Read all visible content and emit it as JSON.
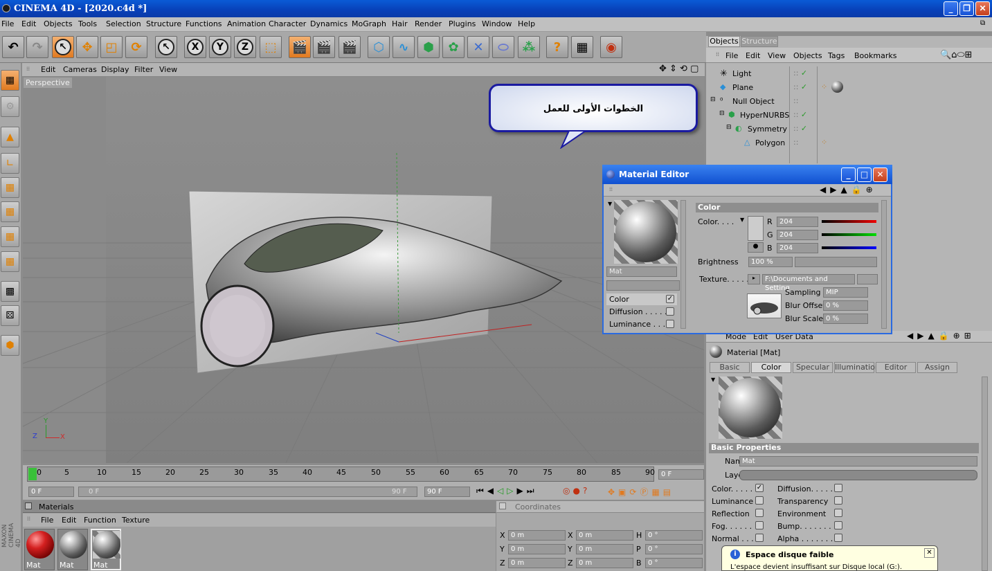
{
  "window": {
    "title": "CINEMA 4D - [2020.c4d *]"
  },
  "menu": [
    "File",
    "Edit",
    "Objects",
    "Tools",
    "Selection",
    "Structure",
    "Functions",
    "Animation",
    "Character",
    "Dynamics",
    "MoGraph",
    "Hair",
    "Render",
    "Plugins",
    "Window",
    "Help"
  ],
  "viewport": {
    "menu": [
      "Edit",
      "Cameras",
      "Display",
      "Filter",
      "View"
    ],
    "label": "Perspective",
    "callout_text": "الخطوات الأولى للعمل",
    "axes": {
      "x": "X",
      "y": "Y",
      "z": "Z"
    }
  },
  "timeline": {
    "ticks": [
      "0",
      "5",
      "10",
      "15",
      "20",
      "25",
      "30",
      "35",
      "40",
      "45",
      "50",
      "55",
      "60",
      "65",
      "70",
      "75",
      "80",
      "85",
      "90"
    ],
    "current_frame": "0 F",
    "start": "0 F",
    "range_start": "0 F",
    "range_end": "90 F",
    "end": "90 F"
  },
  "materials": {
    "title": "Materials",
    "menu": [
      "File",
      "Edit",
      "Function",
      "Texture"
    ],
    "items": [
      {
        "name": "Mat"
      },
      {
        "name": "Mat"
      },
      {
        "name": "Mat"
      }
    ]
  },
  "coordinates": {
    "title": "Coordinates",
    "rows": [
      {
        "a": "X",
        "av": "0 m",
        "b": "X",
        "bv": "0 m",
        "c": "H",
        "cv": "0 °"
      },
      {
        "a": "Y",
        "av": "0 m",
        "b": "Y",
        "bv": "0 m",
        "c": "P",
        "cv": "0 °"
      },
      {
        "a": "Z",
        "av": "0 m",
        "b": "Z",
        "bv": "0 m",
        "c": "B",
        "cv": "0 °"
      }
    ]
  },
  "objects_panel": {
    "tabs": [
      "Objects",
      "Structure"
    ],
    "menu": [
      "File",
      "Edit",
      "View",
      "Objects",
      "Tags",
      "Bookmarks"
    ],
    "tree": [
      {
        "name": "Light"
      },
      {
        "name": "Plane"
      },
      {
        "name": "Null Object"
      },
      {
        "name": "HyperNURBS"
      },
      {
        "name": "Symmetry"
      },
      {
        "name": "Polygon"
      }
    ]
  },
  "material_editor": {
    "title": "Material Editor",
    "preview_name": "Mat",
    "channels": [
      {
        "label": "Color",
        "checked": "✓"
      },
      {
        "label": "Diffusion . . . . .",
        "checked": ""
      },
      {
        "label": "Luminance . . .",
        "checked": ""
      }
    ],
    "section": "Color",
    "color_label": "Color. . . .",
    "r_label": "R",
    "g_label": "G",
    "b_label": "B",
    "r": "204",
    "g": "204",
    "b": "204",
    "brightness_label": "Brightness",
    "brightness": "100 %",
    "texture_label": "Texture. . . . .",
    "texture_path": "F:\\Documents and Setting",
    "sampling_label": "Sampling",
    "sampling": "MIP",
    "blur_offset_label": "Blur Offset",
    "blur_offset": "0 %",
    "blur_scale_label": "Blur Scale",
    "blur_scale": "0 %"
  },
  "attributes": {
    "menu": [
      "Mode",
      "Edit",
      "User Data"
    ],
    "material_title": "Material [Mat]",
    "tabs": [
      "Basic",
      "Color",
      "Specular",
      "Illumination",
      "Editor",
      "Assign"
    ],
    "section": "Basic Properties",
    "name_label": "Name",
    "name_value": "Mat",
    "layer_label": "Layer",
    "left_checks": [
      {
        "label": "Color. . . . .",
        "checked": "✓"
      },
      {
        "label": "Luminance",
        "checked": ""
      },
      {
        "label": "Reflection",
        "checked": ""
      },
      {
        "label": "Fog. . . . . .",
        "checked": ""
      },
      {
        "label": "Normal . . .",
        "checked": ""
      }
    ],
    "right_checks": [
      {
        "label": "Diffusion. . . . . .",
        "checked": ""
      },
      {
        "label": "Transparency",
        "checked": ""
      },
      {
        "label": "Environment",
        "checked": ""
      },
      {
        "label": "Bump. . . . . . .",
        "checked": ""
      },
      {
        "label": "Alpha . . . . . . .",
        "checked": ""
      }
    ]
  },
  "notification": {
    "title": "Espace disque faible",
    "body": "L'espace devient insuffisant sur Disque local (G:)."
  },
  "colors": {
    "titlebar": "#0a4fcf",
    "accent": "#e07a20",
    "callout_bg": "#f4f8ff"
  }
}
